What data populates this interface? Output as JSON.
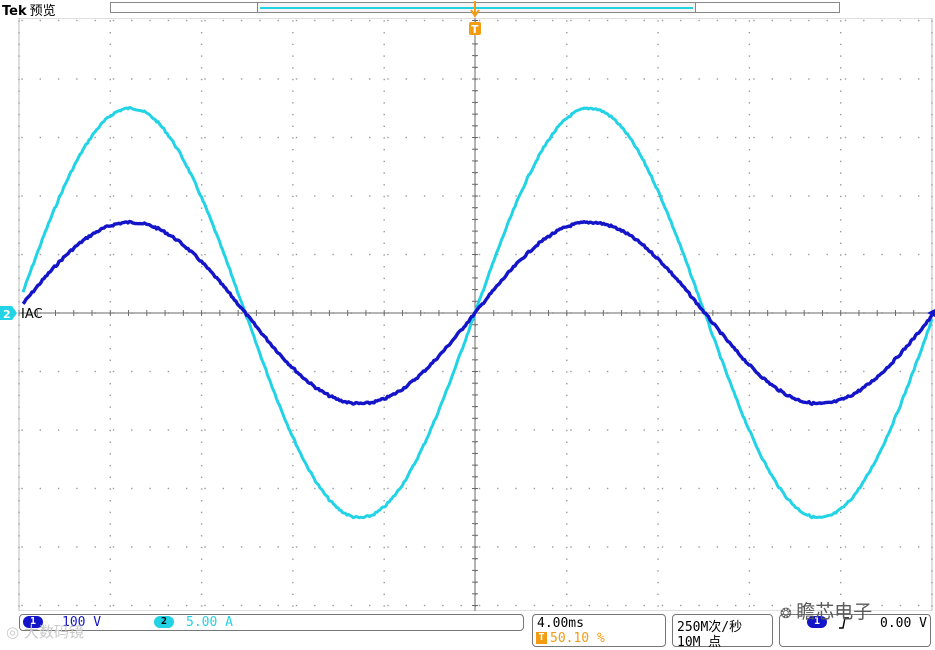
{
  "header": {
    "brand": "Tek",
    "status": "预览"
  },
  "channel_markers": {
    "ch2_label": "2",
    "ground_label": "IAC"
  },
  "trigger_marker_label": "T",
  "channels": {
    "ch1": {
      "badge": "1",
      "scale": "100 V",
      "color": "#1414c8"
    },
    "ch2": {
      "badge": "2",
      "scale": "5.00 A",
      "color": "#22d3e6"
    }
  },
  "timebase": {
    "scale": "4.00ms",
    "trigger_position": "50.10 %",
    "trigger_glyph": "T"
  },
  "acquisition": {
    "sample_rate": "250M次/秒",
    "record_length": "10M 点"
  },
  "trigger": {
    "source": "1",
    "slope_icon": "rising-edge-icon",
    "level": "0.00 V"
  },
  "watermarks": {
    "left": "大数码镜",
    "right": "瞻芯电子"
  },
  "colors": {
    "ch1": "#1414c8",
    "ch2": "#22d3e6",
    "trigger": "#f39c12",
    "grid": "#9a9a9a"
  },
  "waveforms": {
    "ch1": {
      "amplitude_div": 1.55,
      "period_div": 8.0,
      "phase": "sine"
    },
    "ch2": {
      "amplitude_div": 3.5,
      "period_div": 8.0,
      "phase": "sine"
    }
  }
}
